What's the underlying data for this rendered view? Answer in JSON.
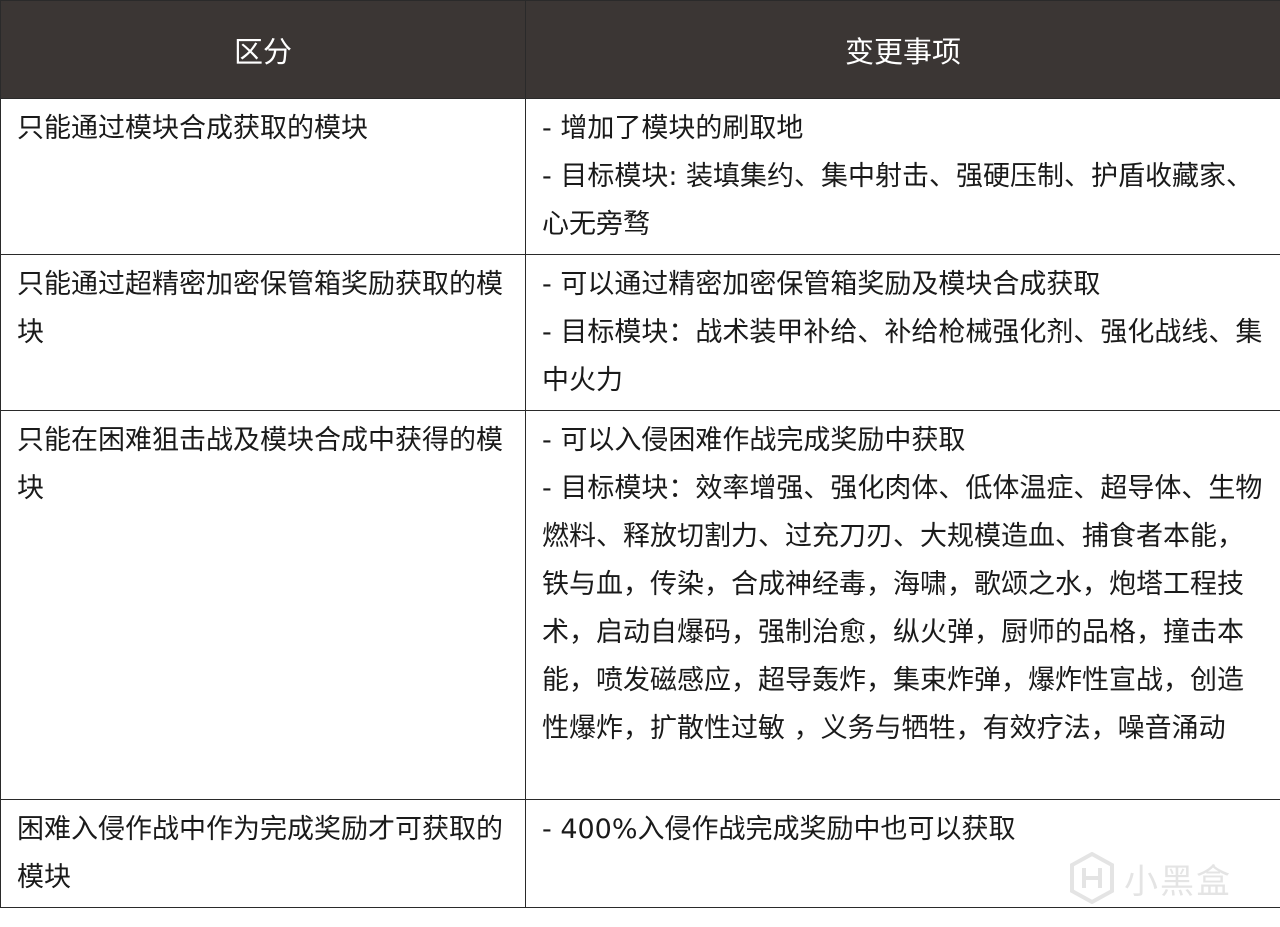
{
  "table": {
    "headers": [
      "区分",
      "变更事项"
    ],
    "rows": [
      {
        "category": "只能通过模块合成获取的模块",
        "changes": [
          "- 增加了模块的刷取地",
          "- 目标模块: 装填集约、集中射击、强硬压制、护盾收藏家、心无旁骛"
        ]
      },
      {
        "category": "只能通过超精密加密保管箱奖励获取的模块",
        "changes": [
          "- 可以通过精密加密保管箱奖励及模块合成获取",
          "- 目标模块：战术装甲补给、补给枪械强化剂、强化战线、集中火力"
        ]
      },
      {
        "category": "只能在困难狙击战及模块合成中获得的模块",
        "changes": [
          "- 可以入侵困难作战完成奖励中获取",
          "- 目标模块：效率增强、强化肉体、低体温症、超导体、生物燃料、释放切割力、过充刀刃、大规模造血、捕食者本能，铁与血，传染，合成神经毒，海啸，歌颂之水，炮塔工程技术，启动自爆码，强制治愈，纵火弹，厨师的品格，撞击本能，喷发磁感应，超导轰炸，集束炸弹，爆炸性宣战，创造性爆炸，扩散性过敏 ，义务与牺牲，有效疗法，噪音涌动"
        ]
      },
      {
        "category": "困难入侵作战中作为完成奖励才可获取的模块",
        "changes": [
          "- 400%入侵作战完成奖励中也可以获取"
        ]
      }
    ]
  },
  "watermark": {
    "text": "小黑盒",
    "icon": "heybox-logo-icon"
  }
}
